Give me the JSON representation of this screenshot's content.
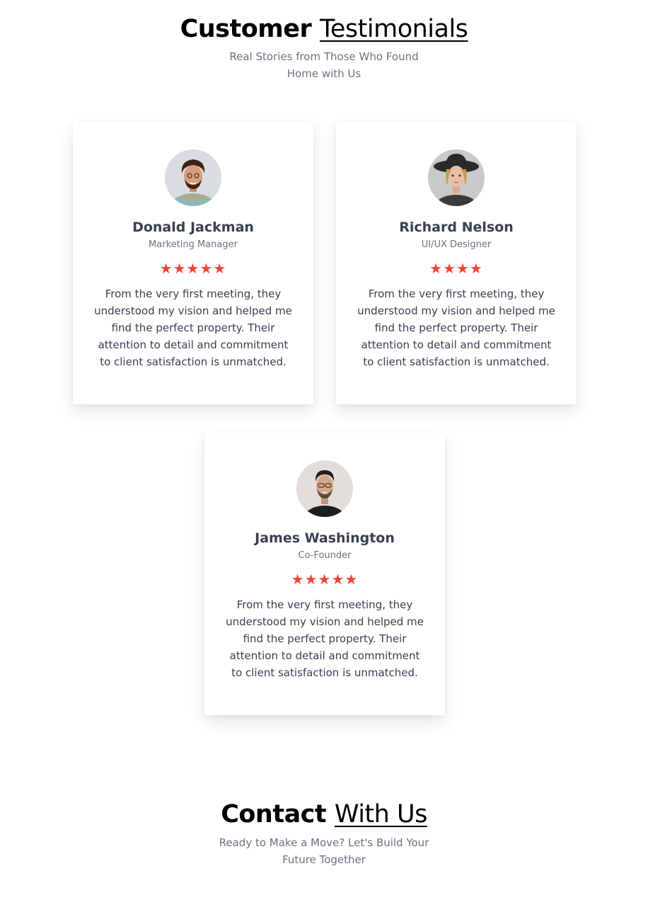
{
  "testimonials_section": {
    "title_bold": "Customer",
    "title_light": "Testimonials",
    "subtitle": "Real Stories from Those Who Found Home with Us"
  },
  "testimonials": [
    {
      "name": "Donald Jackman",
      "role": "Marketing Manager",
      "rating": 5,
      "stars": "★★★★★",
      "quote": "From the very first meeting, they understood my vision and helped me find the perfect property. Their attention to detail and commitment to client satisfaction is unmatched."
    },
    {
      "name": "Richard Nelson",
      "role": "UI/UX Designer",
      "rating": 4,
      "stars": "★★★★",
      "quote": "From the very first meeting, they understood my vision and helped me find the perfect property. Their attention to detail and commitment to client satisfaction is unmatched."
    },
    {
      "name": "James Washington",
      "role": "Co-Founder",
      "rating": 5,
      "stars": "★★★★★",
      "quote": "From the very first meeting, they understood my vision and helped me find the perfect property. Their attention to detail and commitment to client satisfaction is unmatched."
    }
  ],
  "contact_section": {
    "title_bold": "Contact",
    "title_light": "With Us",
    "subtitle": "Ready to Make a Move? Let's Build Your Future Together"
  },
  "colors": {
    "star": "#f44336",
    "heading": "#000000",
    "text": "#374151",
    "muted": "#6b7280"
  }
}
